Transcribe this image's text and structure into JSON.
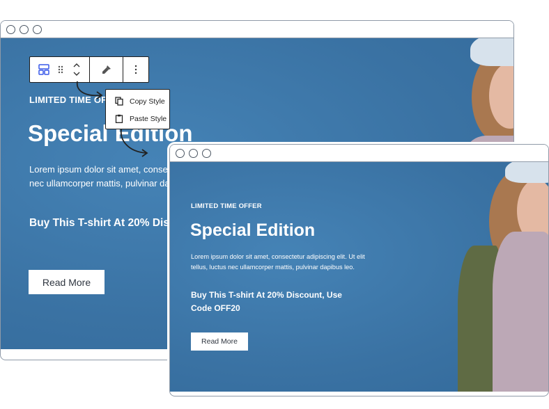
{
  "hero": {
    "eyebrow": "LIMITED TIME OFFER",
    "title": "Special Edition",
    "body": "Lorem ipsum dolor sit amet, consectetur adipiscing elit. Ut elit tellus, luctus nec ullamcorper mattis, pulvinar dapibus leo.",
    "cta": "Buy This T-shirt At 20% Discount, Use Code OFF20",
    "button_label": "Read More"
  },
  "toolbar": {
    "block_icon": "block-layout-icon",
    "drag_icon": "drag-handle-icon",
    "move_icon": "move-up-down-icon",
    "style_icon": "paintbrush-icon",
    "more_icon": "more-options-icon"
  },
  "menu": {
    "items": [
      {
        "label": "Copy Style",
        "icon": "copy-icon"
      },
      {
        "label": "Paste Style",
        "icon": "clipboard-icon"
      }
    ]
  },
  "colors": {
    "hero_bg": "#3d77a8",
    "text": "#ffffff",
    "button_bg": "#ffffff",
    "window_border": "#8f9aa8"
  }
}
